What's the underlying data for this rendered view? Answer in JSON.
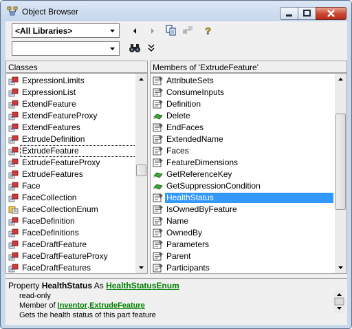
{
  "window": {
    "title": "Object Browser"
  },
  "toolbar": {
    "library_combo": "<All Libraries>",
    "search_combo": "",
    "buttons": [
      "back-icon",
      "forward-icon",
      "copy-icon",
      "view-definition-icon",
      "help-icon",
      "find-icon",
      "expand-icon"
    ]
  },
  "classes": {
    "header": "Classes",
    "items": [
      {
        "label": "ExpressionLimits",
        "icon": "class-icon"
      },
      {
        "label": "ExpressionList",
        "icon": "class-icon"
      },
      {
        "label": "ExtendFeature",
        "icon": "class-icon"
      },
      {
        "label": "ExtendFeatureProxy",
        "icon": "class-icon"
      },
      {
        "label": "ExtendFeatures",
        "icon": "class-icon"
      },
      {
        "label": "ExtrudeDefinition",
        "icon": "class-icon"
      },
      {
        "label": "ExtrudeFeature",
        "icon": "class-icon"
      },
      {
        "label": "ExtrudeFeatureProxy",
        "icon": "class-icon"
      },
      {
        "label": "ExtrudeFeatures",
        "icon": "class-icon"
      },
      {
        "label": "Face",
        "icon": "class-icon"
      },
      {
        "label": "FaceCollection",
        "icon": "class-icon"
      },
      {
        "label": "FaceCollectionEnum",
        "icon": "enum-icon"
      },
      {
        "label": "FaceDefinition",
        "icon": "class-icon"
      },
      {
        "label": "FaceDefinitions",
        "icon": "class-icon"
      },
      {
        "label": "FaceDraftFeature",
        "icon": "class-icon"
      },
      {
        "label": "FaceDraftFeatureProxy",
        "icon": "class-icon"
      },
      {
        "label": "FaceDraftFeatures",
        "icon": "class-icon"
      }
    ],
    "focused_index": 6,
    "scroll_position": 0.48
  },
  "members": {
    "header": "Members of 'ExtrudeFeature'",
    "items": [
      {
        "label": "AttributeSets",
        "icon": "property-icon"
      },
      {
        "label": "ConsumeInputs",
        "icon": "property-icon"
      },
      {
        "label": "Definition",
        "icon": "property-icon"
      },
      {
        "label": "Delete",
        "icon": "method-icon"
      },
      {
        "label": "EndFaces",
        "icon": "property-icon"
      },
      {
        "label": "ExtendedName",
        "icon": "property-icon"
      },
      {
        "label": "Faces",
        "icon": "property-icon"
      },
      {
        "label": "FeatureDimensions",
        "icon": "property-icon"
      },
      {
        "label": "GetReferenceKey",
        "icon": "method-icon"
      },
      {
        "label": "GetSuppressionCondition",
        "icon": "method-icon"
      },
      {
        "label": "HealthStatus",
        "icon": "property-icon"
      },
      {
        "label": "IsOwnedByFeature",
        "icon": "property-icon"
      },
      {
        "label": "Name",
        "icon": "property-icon"
      },
      {
        "label": "OwnedBy",
        "icon": "property-icon"
      },
      {
        "label": "Parameters",
        "icon": "property-icon"
      },
      {
        "label": "Parent",
        "icon": "property-icon"
      },
      {
        "label": "Participants",
        "icon": "property-icon"
      }
    ],
    "selected_index": 10,
    "scroll_position": 0.35
  },
  "details": {
    "prefix": "Property ",
    "member": "HealthStatus",
    "as_text": " As ",
    "type_link": "HealthStatusEnum",
    "readonly": "read-only",
    "member_of": "Member of ",
    "library_link": "Inventor",
    "dot": ".",
    "class_link": "ExtrudeFeature",
    "description": "Gets the health status of this part feature"
  },
  "colors": {
    "selection": "#3399ff",
    "link": "#008000"
  }
}
